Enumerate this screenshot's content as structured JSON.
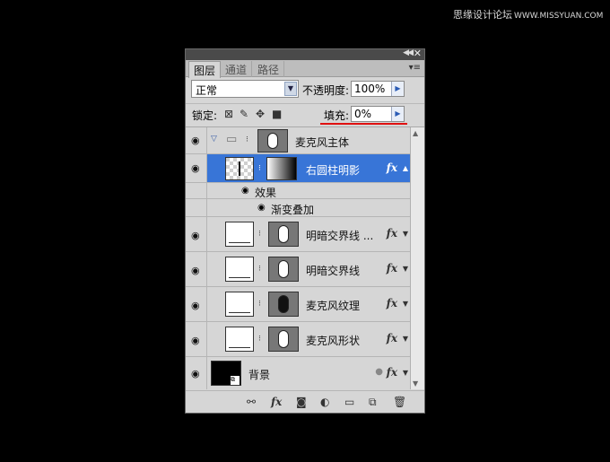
{
  "watermark": {
    "text": "思缘设计论坛",
    "url": "WWW.MISSYUAN.COM"
  },
  "panel": {
    "tabs": [
      "图层",
      "通道",
      "路径"
    ],
    "blend_mode": "正常",
    "opacity_label": "不透明度:",
    "opacity_value": "100%",
    "lock_label": "锁定:",
    "fill_label": "填充:",
    "fill_value": "0%"
  },
  "layers": [
    {
      "name": "麦克风主体",
      "type": "group"
    },
    {
      "name": "右圆柱明影",
      "selected": true,
      "fx": "fx"
    },
    {
      "name": "效果"
    },
    {
      "name": "渐变叠加"
    },
    {
      "name": "明暗交界线 ...",
      "fx": "fx"
    },
    {
      "name": "明暗交界线",
      "fx": "fx"
    },
    {
      "name": "麦克风纹理",
      "fx": "fx"
    },
    {
      "name": "麦克风形状",
      "fx": "fx"
    },
    {
      "name": "背景",
      "fx": "fx"
    }
  ],
  "footer": {
    "fx_label": "fx"
  }
}
